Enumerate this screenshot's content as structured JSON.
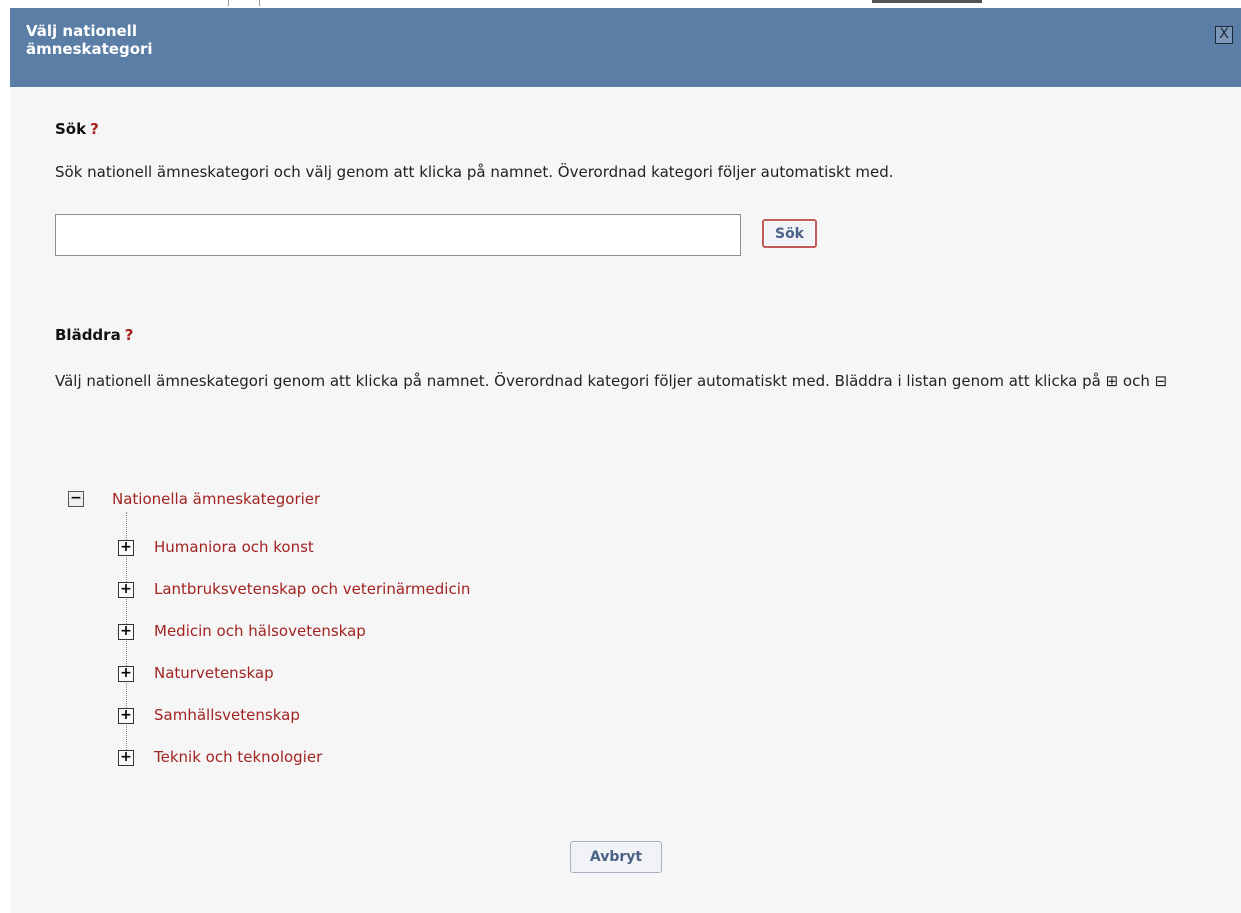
{
  "dialog": {
    "title": "Välj nationell\nämneskategori",
    "close_label": "X"
  },
  "search": {
    "heading": "Sök",
    "help": "?",
    "description": "Sök nationell ämneskategori och välj genom att klicka på namnet. Överordnad kategori följer automatiskt med.",
    "input_value": "",
    "button_label": "Sök"
  },
  "browse": {
    "heading": "Bläddra",
    "help": "?",
    "description": "Välj nationell ämneskategori genom att klicka på namnet. Överordnad kategori följer automatiskt med. Bläddra i listan genom att klicka på ⊞ och ⊟"
  },
  "tree": {
    "root": {
      "label": "Nationella ämneskategorier",
      "toggle": "−"
    },
    "children": [
      {
        "label": "Humaniora och konst",
        "toggle": "+"
      },
      {
        "label": "Lantbruksvetenskap och veterinärmedicin",
        "toggle": "+"
      },
      {
        "label": "Medicin och hälsovetenskap",
        "toggle": "+"
      },
      {
        "label": "Naturvetenskap",
        "toggle": "+"
      },
      {
        "label": "Samhällsvetenskap",
        "toggle": "+"
      },
      {
        "label": "Teknik och teknologier",
        "toggle": "+"
      }
    ]
  },
  "footer": {
    "cancel_label": "Avbryt"
  },
  "colors": {
    "titlebar": "#5b7ea6",
    "link": "#a22422",
    "help": "#a4231b",
    "button_text": "#4a6285"
  }
}
